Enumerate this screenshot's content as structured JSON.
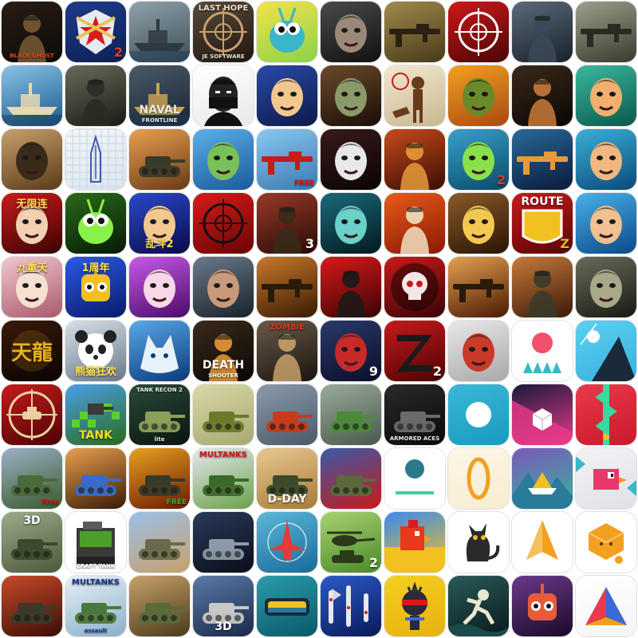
{
  "grid": {
    "icons": [
      {
        "name": "soldier",
        "bg": [
          "#2a1d14",
          "#0d0a07"
        ],
        "motif": "soldier",
        "accent": "#7a5a34",
        "label": "BLACK GHOST",
        "labelColor": "#e24a1f",
        "labelPos": "bottom"
      },
      {
        "name": "military-badge",
        "bg": [
          "#1c3c8a",
          "#0e1f55"
        ],
        "motif": "badge",
        "accent": "#e6c45a",
        "badge": "2",
        "badgeColor": "#e23a2a"
      },
      {
        "name": "warship",
        "bg": [
          "#8fa3ad",
          "#3d4d55"
        ],
        "motif": "ship",
        "accent": "#2f3a40"
      },
      {
        "name": "sniper-scope",
        "bg": [
          "#5a4a3a",
          "#1f1711"
        ],
        "motif": "scope",
        "accent": "#c8a06a",
        "label": "LAST HOPE",
        "labelColor": "#e8e0d0",
        "labelPos": "top",
        "sublabel": "JE SOFTWARE"
      },
      {
        "name": "cartoon-bug",
        "bg": [
          "#f2e24a",
          "#8dd24a"
        ],
        "motif": "bug",
        "accent": "#3ab6c8"
      },
      {
        "name": "zombie-face",
        "bg": [
          "#4a4a4a",
          "#111111"
        ],
        "motif": "face",
        "accent": "#9a8878"
      },
      {
        "name": "rifleman",
        "bg": [
          "#a08a4a",
          "#4a3a1a"
        ],
        "motif": "rifle",
        "accent": "#2a2014"
      },
      {
        "name": "red-scope",
        "bg": [
          "#d01818",
          "#4a0606"
        ],
        "motif": "scope",
        "accent": "#ffffff"
      },
      {
        "name": "commando",
        "bg": [
          "#5a6a7a",
          "#1a222a"
        ],
        "motif": "soldier",
        "accent": "#3a4a5a"
      },
      {
        "name": "sniper-aim",
        "bg": [
          "#9aa08a",
          "#3a3a30"
        ],
        "motif": "rifle",
        "accent": "#2a2a22"
      },
      {
        "name": "sailing-ship",
        "bg": [
          "#8ac2e8",
          "#1a5a8a"
        ],
        "motif": "ship",
        "accent": "#e8d8b0"
      },
      {
        "name": "dark-soldier",
        "bg": [
          "#6a6a5a",
          "#1a1a14"
        ],
        "motif": "soldier",
        "accent": "#2a2a22"
      },
      {
        "name": "naval-front",
        "bg": [
          "#4a5a6a",
          "#1a2430"
        ],
        "motif": "ship",
        "accent": "#c8a050",
        "label": "NAVAL",
        "labelColor": "#e8e8e8",
        "labelPos": "bottom",
        "sublabel": "FRONTLINE"
      },
      {
        "name": "masked-man",
        "bg": [
          "#ffffff",
          "#e8e8e8"
        ],
        "motif": "masked",
        "accent": "#111111"
      },
      {
        "name": "hero-boy",
        "bg": [
          "#2a4aa8",
          "#0a1a4a"
        ],
        "motif": "face",
        "accent": "#f2c890"
      },
      {
        "name": "zombie-roar",
        "bg": [
          "#6a4a2a",
          "#1a0e06"
        ],
        "motif": "face",
        "accent": "#8a9a6a"
      },
      {
        "name": "hunter-dog",
        "bg": [
          "#f2e8d0",
          "#c8b890"
        ],
        "motif": "hunter",
        "accent": "#6a3a1a"
      },
      {
        "name": "green-beast",
        "bg": [
          "#f2a020",
          "#a84a10"
        ],
        "motif": "face",
        "accent": "#6a8a2a"
      },
      {
        "name": "gunslinger",
        "bg": [
          "#3a2a1a",
          "#0a0604"
        ],
        "motif": "soldier",
        "accent": "#c87a3a"
      },
      {
        "name": "crazy-pilot",
        "bg": [
          "#3ab8a0",
          "#0a5a4a"
        ],
        "motif": "face",
        "accent": "#f2b070"
      },
      {
        "name": "pilot-mask",
        "bg": [
          "#c8a06a",
          "#5a3a1a"
        ],
        "motif": "face",
        "accent": "#3a2a1a"
      },
      {
        "name": "doodle-ship",
        "bg": [
          "#f2f6fa",
          "#dce6ee"
        ],
        "motif": "sketch",
        "accent": "#3a5aa8"
      },
      {
        "name": "tank-battle",
        "bg": [
          "#e8a050",
          "#6a3a14"
        ],
        "motif": "tank",
        "accent": "#3a3a2a"
      },
      {
        "name": "zombie-cop",
        "bg": [
          "#5ab0e8",
          "#1a5a9a"
        ],
        "motif": "face",
        "accent": "#7ac05a"
      },
      {
        "name": "gun-free",
        "bg": [
          "#8ac8f0",
          "#3a7ab0"
        ],
        "motif": "rifle",
        "accent": "#c81a1a",
        "badge": "FREE",
        "badgeColor": "#d81a1a"
      },
      {
        "name": "zombie-santa",
        "bg": [
          "#3a1a1a",
          "#0a0404"
        ],
        "motif": "face",
        "accent": "#e8e8e8"
      },
      {
        "name": "fire-squad",
        "bg": [
          "#c84a1a",
          "#3a0e04"
        ],
        "motif": "soldier",
        "accent": "#e89a3a"
      },
      {
        "name": "zombie-cap",
        "bg": [
          "#3aa0c8",
          "#0a4a6a"
        ],
        "motif": "face",
        "accent": "#8ae04a",
        "badge": "2",
        "badgeColor": "#e23a2a"
      },
      {
        "name": "assault-gun",
        "bg": [
          "#2a6a9a",
          "#0a1a3a"
        ],
        "motif": "rifle",
        "accent": "#e89a3a"
      },
      {
        "name": "shades-hero",
        "bg": [
          "#3ab0d8",
          "#0a4a7a"
        ],
        "motif": "face",
        "accent": "#f0b880"
      },
      {
        "name": "anime-fighter",
        "bg": [
          "#c81a1a",
          "#3a0404"
        ],
        "motif": "face",
        "accent": "#f2d0b0",
        "label": "无限连",
        "labelColor": "#ffe050",
        "labelPos": "top"
      },
      {
        "name": "green-spider",
        "bg": [
          "#2a6a1a",
          "#051a04"
        ],
        "motif": "bug",
        "accent": "#8af04a"
      },
      {
        "name": "brawl-2",
        "bg": [
          "#2a4ac8",
          "#0a0a4a"
        ],
        "motif": "face",
        "accent": "#f2c890",
        "label": "乱斗2",
        "labelColor": "#ffe050",
        "labelPos": "bottom"
      },
      {
        "name": "red-target",
        "bg": [
          "#d81a1a",
          "#6a0404"
        ],
        "motif": "scope",
        "accent": "#111111"
      },
      {
        "name": "sniper-3",
        "bg": [
          "#9a3a2a",
          "#2a0a04"
        ],
        "motif": "soldier",
        "accent": "#3a2a1a",
        "badge": "3",
        "badgeColor": "#ffffff"
      },
      {
        "name": "zombie-teal",
        "bg": [
          "#1a6a7a",
          "#041a20"
        ],
        "motif": "face",
        "accent": "#6ad0c8"
      },
      {
        "name": "runner",
        "bg": [
          "#e85a1a",
          "#8a1a04"
        ],
        "motif": "soldier",
        "accent": "#f2e0c0"
      },
      {
        "name": "dwarf-cook",
        "bg": [
          "#8a5a2a",
          "#2a1404"
        ],
        "motif": "face",
        "accent": "#f2c850"
      },
      {
        "name": "route-z",
        "bg": [
          "#c81a1a",
          "#5a0404"
        ],
        "motif": "sign",
        "accent": "#f2c020",
        "label": "ROUTE",
        "labelColor": "#ffffff",
        "labelPos": "top",
        "badge": "Z",
        "badgeColor": "#e8b020"
      },
      {
        "name": "mafia-gun",
        "bg": [
          "#4ab0e8",
          "#0a4a8a"
        ],
        "motif": "face",
        "accent": "#f0c090"
      },
      {
        "name": "anime-girl",
        "bg": [
          "#f2c8d0",
          "#a85a6a"
        ],
        "motif": "face",
        "accent": "#f8e0d0",
        "label": "九重天",
        "labelColor": "#ffe050",
        "labelPos": "top"
      },
      {
        "name": "robot-anniv",
        "bg": [
          "#2a5ae8",
          "#0a1a6a"
        ],
        "motif": "robot",
        "accent": "#f2c020",
        "label": "1周年",
        "labelColor": "#ffe050",
        "labelPos": "top"
      },
      {
        "name": "angel-girl",
        "bg": [
          "#c85ae8",
          "#4a0a6a"
        ],
        "motif": "face",
        "accent": "#f8d8e8"
      },
      {
        "name": "tough-man",
        "bg": [
          "#6a7a8a",
          "#1a222a"
        ],
        "motif": "face",
        "accent": "#c89a7a"
      },
      {
        "name": "cowboy-gun",
        "bg": [
          "#c87a2a",
          "#3a1a04"
        ],
        "motif": "rifle",
        "accent": "#2a1a0a"
      },
      {
        "name": "spec-ops",
        "bg": [
          "#d81a1a",
          "#3a0404"
        ],
        "motif": "soldier",
        "accent": "#1a1a1a"
      },
      {
        "name": "skull-red",
        "bg": [
          "#c81a1a",
          "#3a0404"
        ],
        "motif": "skull",
        "accent": "#f2e8e8"
      },
      {
        "name": "sniper-fire",
        "bg": [
          "#e8a050",
          "#4a1a04"
        ],
        "motif": "rifle",
        "accent": "#2a1a0a"
      },
      {
        "name": "soldier-smoke",
        "bg": [
          "#c87a3a",
          "#3a1a0a"
        ],
        "motif": "soldier",
        "accent": "#3a3a2a"
      },
      {
        "name": "zombie-grin",
        "bg": [
          "#6a6a5a",
          "#1a1a14"
        ],
        "motif": "face",
        "accent": "#a8a88a"
      },
      {
        "name": "dragon-text",
        "bg": [
          "#3a1a0a",
          "#0a0402"
        ],
        "motif": "text",
        "accent": "#e8b020",
        "label": "天龍",
        "labelColor": "#e8b020",
        "labelPos": "mid"
      },
      {
        "name": "panda-warrior",
        "bg": [
          "#d8e0e8",
          "#6a7a8a"
        ],
        "motif": "panda",
        "accent": "#222222",
        "label": "熊猫狂欢",
        "labelColor": "#ffe050",
        "labelPos": "bottom"
      },
      {
        "name": "ice-wolf",
        "bg": [
          "#5aa8e8",
          "#0a3a7a"
        ],
        "motif": "wolf",
        "accent": "#e8f2fa"
      },
      {
        "name": "death-shooter",
        "bg": [
          "#3a2a1a",
          "#0a0604"
        ],
        "motif": "soldier",
        "accent": "#e89a3a",
        "label": "DEATH",
        "labelColor": "#ffffff",
        "labelPos": "bottom",
        "sublabel": "SHOOTER"
      },
      {
        "name": "zombie-shooter",
        "bg": [
          "#6a5a4a",
          "#1a140e"
        ],
        "motif": "soldier",
        "accent": "#c8a06a",
        "label": "ZOMBIE",
        "labelColor": "#d83a1a",
        "labelPos": "top"
      },
      {
        "name": "red-hair-girl",
        "bg": [
          "#2a3a6a",
          "#0a0e2a"
        ],
        "motif": "face",
        "accent": "#c82a2a",
        "badge": "9",
        "badgeColor": "#ffffff"
      },
      {
        "name": "z-logo-2",
        "bg": [
          "#c81a1a",
          "#4a0404"
        ],
        "motif": "zlogo",
        "accent": "#1a1a1a",
        "badge": "2",
        "badgeColor": "#ffffff"
      },
      {
        "name": "cartoon-soldier",
        "bg": [
          "#e8e8e8",
          "#a8a8a8"
        ],
        "motif": "face",
        "accent": "#c83a2a"
      },
      {
        "name": "pink-ball-spikes",
        "bg": [
          "#ffffff",
          "#ffffff"
        ],
        "motif": "ballspike",
        "accent": "#f0506a",
        "accent2": "#3ab8c8"
      },
      {
        "name": "ball-mountain",
        "bg": [
          "#5ad0f0",
          "#3ab0e0"
        ],
        "motif": "mountain",
        "accent": "#1a2a3a"
      },
      {
        "name": "tank-crosshair",
        "bg": [
          "#c81a1a",
          "#4a0404"
        ],
        "motif": "tankscope",
        "accent": "#e8d0a0"
      },
      {
        "name": "pixel-tank-hd",
        "bg": [
          "#4aa0e8",
          "#2a6a1a"
        ],
        "motif": "pixeltank",
        "accent": "#5ad02a",
        "label": "TANK",
        "labelColor": "#f2e020",
        "labelPos": "bottom"
      },
      {
        "name": "tank-recon-2",
        "bg": [
          "#2a4a3a",
          "#0a140e"
        ],
        "motif": "tank",
        "accent": "#8aa05a",
        "label": "TANK RECON 2",
        "labelColor": "#e8e8e8",
        "labelPos": "top",
        "sublabel": "lite"
      },
      {
        "name": "tiny-tank",
        "bg": [
          "#d8d8a8",
          "#a8a870"
        ],
        "motif": "tank",
        "accent": "#6a7a2a"
      },
      {
        "name": "red-tank",
        "bg": [
          "#8a9aaa",
          "#4a5a6a"
        ],
        "motif": "tank",
        "accent": "#c83a1a"
      },
      {
        "name": "green-tank-3d",
        "bg": [
          "#9aaa9a",
          "#4a5a4a"
        ],
        "motif": "tank",
        "accent": "#4a8a3a"
      },
      {
        "name": "armored-aces",
        "bg": [
          "#2a2a2a",
          "#0a0a0a"
        ],
        "motif": "tank",
        "accent": "#6a6a6a",
        "label": "ARMORED ACES",
        "labelColor": "#e8e8e8",
        "labelPos": "bottom"
      },
      {
        "name": "white-ball-teal",
        "bg": [
          "#3ab8d8",
          "#1a9ac0"
        ],
        "motif": "ball",
        "accent": "#ffffff"
      },
      {
        "name": "cube-maze",
        "bg": [
          "#1a1a3a",
          "#e83a8a"
        ],
        "motif": "cube",
        "accent": "#ffffff"
      },
      {
        "name": "red-stripe",
        "bg": [
          "#e83a4a",
          "#c81a2a"
        ],
        "motif": "stripe",
        "accent": "#3ad8a0"
      },
      {
        "name": "camo-tank",
        "bg": [
          "#9ab0c8",
          "#3a5a2a"
        ],
        "motif": "tank",
        "accent": "#4a6a3a",
        "badge": "Free",
        "badgeColor": "#d81a1a"
      },
      {
        "name": "blue-robot-tank",
        "bg": [
          "#e8a050",
          "#3a1a04"
        ],
        "motif": "tank",
        "accent": "#3a6ac8"
      },
      {
        "name": "tank-explosion-free",
        "bg": [
          "#e8a020",
          "#6a1a04"
        ],
        "motif": "tank",
        "accent": "#3a3a2a",
        "badge": "FREE",
        "badgeColor": "#2ab82a"
      },
      {
        "name": "multanks",
        "bg": [
          "#e8e8f0",
          "#6aa04a"
        ],
        "motif": "tank",
        "accent": "#3a6a2a",
        "label": "MULTANKS",
        "labelColor": "#d81a1a",
        "labelPos": "top"
      },
      {
        "name": "d-day",
        "bg": [
          "#e8c890",
          "#a87a3a"
        ],
        "motif": "tank",
        "accent": "#3a4a2a",
        "label": "D-DAY",
        "labelColor": "#ffffff",
        "labelPos": "bottom"
      },
      {
        "name": "usa-tank",
        "bg": [
          "#3a5aa8",
          "#c81a1a"
        ],
        "motif": "tank",
        "accent": "#5a6a3a"
      },
      {
        "name": "ball-teal-line",
        "bg": [
          "#ffffff",
          "#ffffff"
        ],
        "motif": "ballline",
        "accent": "#2a7a8a",
        "accent2": "#3ad0a0"
      },
      {
        "name": "orange-ring",
        "bg": [
          "#fdf6e8",
          "#f8ecd0"
        ],
        "motif": "ring",
        "accent": "#f2a020"
      },
      {
        "name": "paper-boat",
        "bg": [
          "#7a5ab8",
          "#3ab0a0"
        ],
        "motif": "paperboat",
        "accent": "#f2c020"
      },
      {
        "name": "pink-bird",
        "bg": [
          "#f2f2f6",
          "#e0e0e8"
        ],
        "motif": "bird",
        "accent": "#e83a6a"
      },
      {
        "name": "tank-3d",
        "bg": [
          "#9aaa8a",
          "#4a5a3a"
        ],
        "motif": "tank",
        "accent": "#3a4a2a",
        "label": "3D",
        "labelColor": "#ffffff",
        "labelPos": "top"
      },
      {
        "name": "craft-tank",
        "bg": [
          "#ffffff",
          "#ffffff"
        ],
        "motif": "crafttank",
        "accent": "#4aa02a",
        "label": "CRAFT TANK",
        "labelColor": "#ffffff",
        "labelPos": "bottom"
      },
      {
        "name": "desert-tank",
        "bg": [
          "#9ac0e8",
          "#c8a06a"
        ],
        "motif": "tank",
        "accent": "#6a6a4a"
      },
      {
        "name": "night-tank",
        "bg": [
          "#2a3a5a",
          "#0a0e1a"
        ],
        "motif": "tank",
        "accent": "#8a9aaa"
      },
      {
        "name": "jet-radar",
        "bg": [
          "#5ab8d8",
          "#1a6a9a"
        ],
        "motif": "jet",
        "accent": "#e83a3a"
      },
      {
        "name": "heli-tank-2",
        "bg": [
          "#a8d070",
          "#4a8a2a"
        ],
        "motif": "heli",
        "accent": "#2a3a1a",
        "badge": "2",
        "badgeColor": "#ffffff"
      },
      {
        "name": "pixel-rooster",
        "bg": [
          "#3a8af0",
          "#f2c020"
        ],
        "motif": "rooster",
        "accent": "#e83a1a"
      },
      {
        "name": "black-cat",
        "bg": [
          "#ffffff",
          "#ffffff"
        ],
        "motif": "cat",
        "accent": "#2a2a2a"
      },
      {
        "name": "orange-arrow",
        "bg": [
          "#ffffff",
          "#ffffff"
        ],
        "motif": "arrow",
        "accent": "#f2a020"
      },
      {
        "name": "orange-cube",
        "bg": [
          "#ffffff",
          "#ffffff"
        ],
        "motif": "jelly",
        "accent": "#f2a020"
      },
      {
        "name": "sherman-tank",
        "bg": [
          "#c84a2a",
          "#3a0e04"
        ],
        "motif": "tank",
        "accent": "#3a3a2a"
      },
      {
        "name": "multanks-assault",
        "bg": [
          "#e8f0f8",
          "#8ab0c8"
        ],
        "motif": "tank",
        "accent": "#4a7a3a",
        "label": "MULTANKS",
        "labelColor": "#1a3a8a",
        "labelPos": "top",
        "sublabel": "assault"
      },
      {
        "name": "ww2-tank",
        "bg": [
          "#c8a06a",
          "#4a3a1a"
        ],
        "motif": "tank",
        "accent": "#5a6a3a"
      },
      {
        "name": "steel-tank-3d",
        "bg": [
          "#5a7aa8",
          "#1a2a4a"
        ],
        "motif": "tank",
        "accent": "#c8c8c8",
        "label": "3D",
        "labelColor": "#ffffff",
        "labelPos": "bottom"
      },
      {
        "name": "submarine-scope",
        "bg": [
          "#3ab8c8",
          "#0a5a6a"
        ],
        "motif": "subscope",
        "accent": "#f2c020"
      },
      {
        "name": "blue-battleships",
        "bg": [
          "#2a5ac8",
          "#0a1a5a"
        ],
        "motif": "ships",
        "accent": "#e8e8e8"
      },
      {
        "name": "ninja-yellow",
        "bg": [
          "#f2d020",
          "#e8b010"
        ],
        "motif": "ninja",
        "accent": "#2a2a3a"
      },
      {
        "name": "swamp-runner",
        "bg": [
          "#2a5a5a",
          "#0a1a1a"
        ],
        "motif": "runner",
        "accent": "#e8e8d0"
      },
      {
        "name": "robot-astro",
        "bg": [
          "#6a3a8a",
          "#1a0a2a"
        ],
        "motif": "robot",
        "accent": "#e85a3a"
      },
      {
        "name": "color-triangle",
        "bg": [
          "#ffffff",
          "#f4f4f4"
        ],
        "motif": "triangle",
        "accent": "#e83a4a",
        "accent2": "#3a6ad8"
      }
    ]
  }
}
